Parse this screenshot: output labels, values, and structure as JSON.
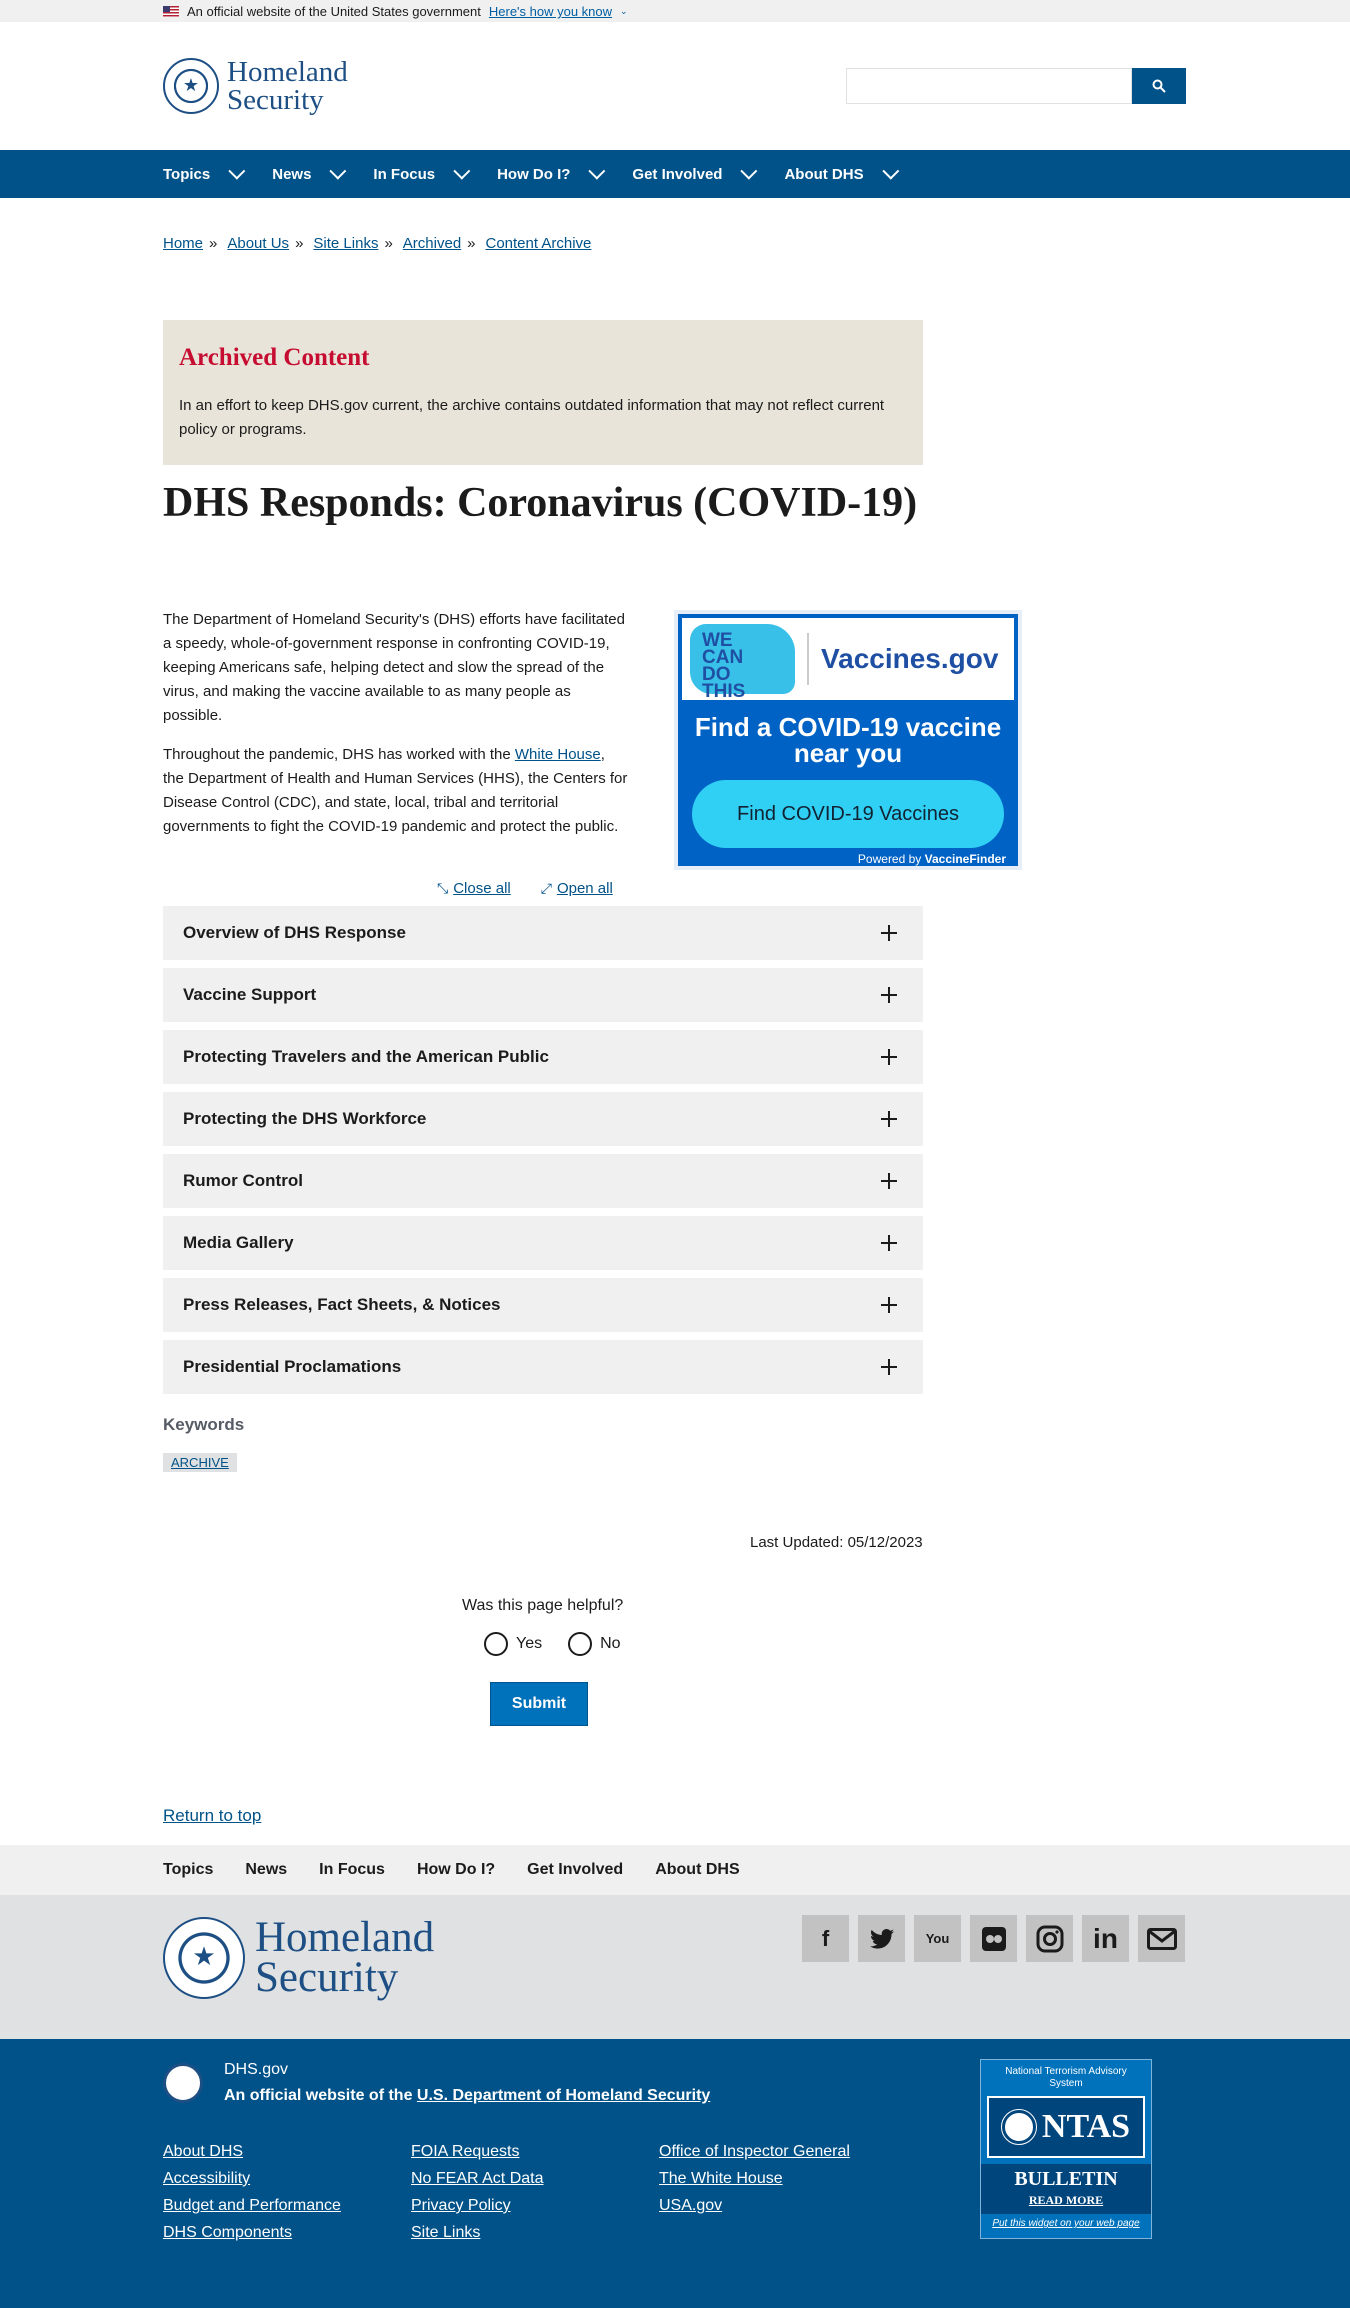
{
  "gov_banner": {
    "text": "An official website of the United States government",
    "link": "Here's how you know"
  },
  "header": {
    "logo_line1": "Homeland",
    "logo_line2": "Security",
    "search_placeholder": ""
  },
  "nav": {
    "items": [
      "Topics",
      "News",
      "In Focus",
      "How Do I?",
      "Get Involved",
      "About DHS"
    ]
  },
  "breadcrumb": [
    "Home",
    "About Us",
    "Site Links",
    "Archived",
    "Content Archive"
  ],
  "archived": {
    "title": "Archived Content",
    "text": "In an effort to keep DHS.gov current, the archive contains outdated information that may not reflect current policy or programs."
  },
  "page_title": "DHS Responds: Coronavirus (COVID-19)",
  "intro": {
    "p1": "The Department of Homeland Security's (DHS) efforts have facilitated a speedy, whole-of-government response in confronting COVID-19, keeping Americans safe, helping detect and slow the spread of the virus, and making the vaccine available to as many people as possible.",
    "p2_before": "Throughout the pandemic, DHS has worked with the ",
    "p2_link": "White House",
    "p2_after": ", the Department of Health and Human Services (HHS), the Centers for Disease Control (CDC), and state, local, tribal and territorial governments to fight the COVID-19 pandemic and protect the public."
  },
  "vaccine_ad": {
    "we": "WE",
    "can": "CAN",
    "do": "DO",
    "this": "THIS",
    "domain": "Vaccines.gov",
    "headline1": "Find a COVID-19 vaccine",
    "headline2": "near you",
    "button": "Find COVID-19 Vaccines",
    "powered_prefix": "Powered by ",
    "powered_brand": "VaccineFinder"
  },
  "accordion_controls": {
    "close_all": "Close all",
    "open_all": "Open all"
  },
  "accordion": [
    "Overview of DHS Response",
    "Vaccine Support",
    "Protecting Travelers and the American Public",
    "Protecting the DHS Workforce",
    "Rumor Control",
    "Media Gallery",
    "Press Releases, Fact Sheets, & Notices",
    "Presidential Proclamations"
  ],
  "keywords": {
    "label": "Keywords",
    "tag": "ARCHIVE"
  },
  "last_updated": "Last Updated: 05/12/2023",
  "feedback": {
    "question": "Was this page helpful?",
    "yes": "Yes",
    "no": "No",
    "submit": "Submit"
  },
  "return_to_top": "Return to top",
  "footer_nav": [
    "Topics",
    "News",
    "In Focus",
    "How Do I?",
    "Get Involved",
    "About DHS"
  ],
  "footer_logo": {
    "line1": "Homeland",
    "line2": "Security"
  },
  "social_icons": [
    "facebook-icon",
    "twitter-icon",
    "youtube-icon",
    "flickr-icon",
    "instagram-icon",
    "linkedin-icon",
    "email-icon"
  ],
  "footer_bottom": {
    "site": "DHS.gov",
    "official_prefix": "An official website of the ",
    "official_link": "U.S. Department of Homeland Security",
    "links": [
      "About DHS",
      "FOIA Requests",
      "Office of Inspector General",
      "Accessibility",
      "No FEAR Act Data",
      "The White House",
      "Budget and Performance",
      "Privacy Policy",
      "USA.gov",
      "DHS Components",
      "Site Links"
    ]
  },
  "ntas": {
    "top": "National Terrorism Advisory System",
    "word": "NTAS",
    "bulletin": "BULLETIN",
    "read_more": "READ MORE",
    "widget": "Put this widget on your web page"
  },
  "colors": {
    "primary": "#005288",
    "archived_title": "#c60c30",
    "archived_bg": "#e8e4d9",
    "accordion_bg": "#f0f0f0"
  }
}
